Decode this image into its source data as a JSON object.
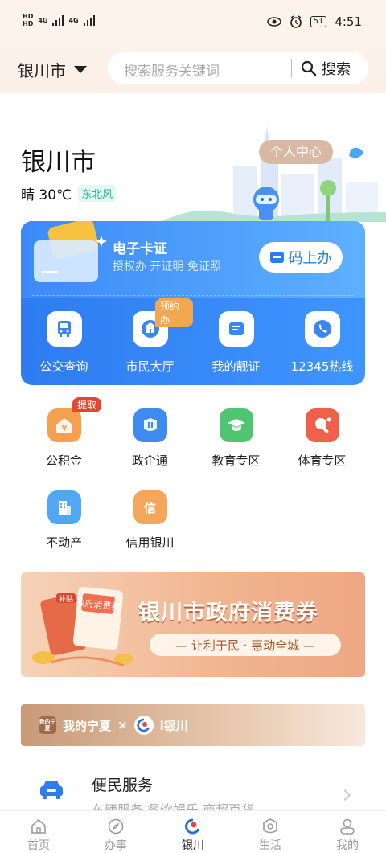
{
  "status_bar": {
    "sim1": "HD",
    "sim2": "HD",
    "net1": "4G",
    "net2": "4G",
    "battery": "51",
    "time": "4:51"
  },
  "header": {
    "city": "银川市",
    "search_placeholder": "搜索服务关键词",
    "search_button": "搜索"
  },
  "hero": {
    "city_title": "银川市",
    "weather": "晴 30℃",
    "wind": "东北风",
    "personal_center": "个人中心"
  },
  "ecard": {
    "title": "电子卡证",
    "subtitle": "授权办 开证明 免证照",
    "button": "码上办",
    "items": [
      {
        "label": "公交查询",
        "icon": "bus-icon"
      },
      {
        "label": "市民大厅",
        "icon": "hall-icon",
        "badge": "预约办"
      },
      {
        "label": "我的靓证",
        "icon": "certificate-icon"
      },
      {
        "label": "12345热线",
        "icon": "phone-icon"
      }
    ]
  },
  "services": {
    "items": [
      {
        "label": "公积金",
        "icon": "fund-icon",
        "glyph": "¥",
        "color": "#f5a04f",
        "badge": "提取"
      },
      {
        "label": "政企通",
        "icon": "enterprise-icon",
        "glyph": "el",
        "color": "#3f8bf0"
      },
      {
        "label": "教育专区",
        "icon": "education-icon",
        "glyph": "🎓",
        "color": "#4fc572"
      },
      {
        "label": "体育专区",
        "icon": "sports-icon",
        "glyph": "●",
        "color": "#f0604b"
      },
      {
        "label": "不动产",
        "icon": "real-estate-icon",
        "glyph": "▦",
        "color": "#52a7f2"
      },
      {
        "label": "信用银川",
        "icon": "credit-icon",
        "glyph": "信",
        "color": "#f4a65a"
      }
    ]
  },
  "banner": {
    "title": "银川市政府消费券",
    "subtitle": "— 让利于民 · 惠动全城 —",
    "ticket_text": "政府消费券",
    "tag": "补贴"
  },
  "cobrand": {
    "left_logo": "我的宁夏",
    "left": "我的宁夏",
    "cross": "×",
    "right": "i银川"
  },
  "convenience": {
    "title": "便民服务",
    "subtitle": "车辆服务 餐饮娱乐 商超百货"
  },
  "tabbar": {
    "items": [
      {
        "label": "首页",
        "icon": "home-icon",
        "active": false
      },
      {
        "label": "办事",
        "icon": "compass-icon",
        "active": false
      },
      {
        "label": "银川",
        "icon": "yinchuan-logo-icon",
        "active": true
      },
      {
        "label": "生活",
        "icon": "life-icon",
        "active": false
      },
      {
        "label": "我的",
        "icon": "user-icon",
        "active": false
      }
    ]
  },
  "colors": {
    "card_blue": "#2e7cf0",
    "header_bg": "#fcf3ea",
    "banner_orange": "#f1b48f"
  }
}
